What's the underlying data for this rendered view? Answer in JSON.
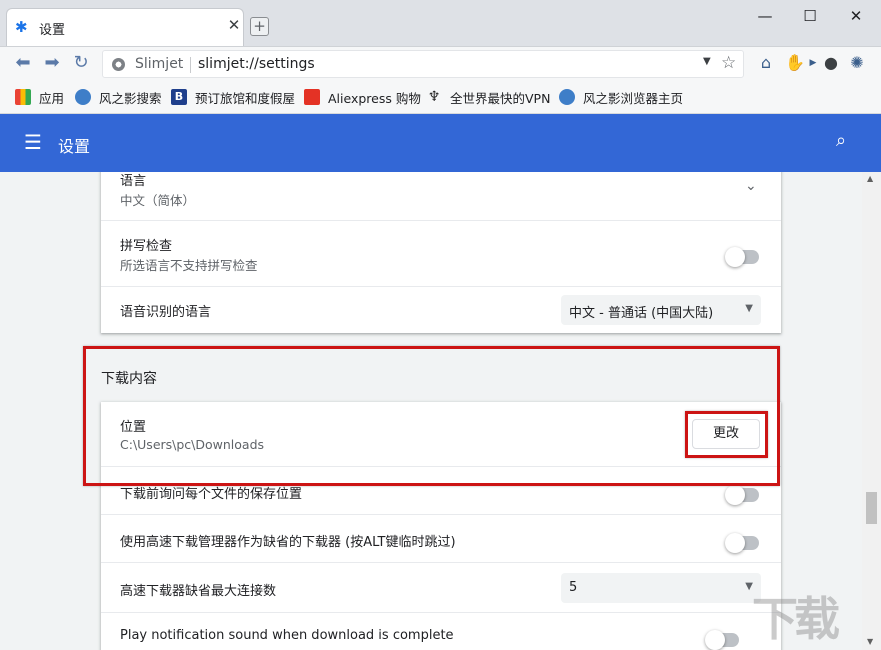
{
  "window": {
    "tab_title": "设置",
    "new_tab_symbol": "+",
    "close_tab_symbol": "✕",
    "minimize_symbol": "—",
    "maximize_symbol": "☐",
    "close_symbol": "✕"
  },
  "toolbar": {
    "site_name": "Slimjet",
    "url": "slimjet://settings"
  },
  "bookmarks": [
    {
      "label": "应用",
      "icon": "apps-grid-icon"
    },
    {
      "label": "风之影搜索",
      "icon": "globe-icon"
    },
    {
      "label": "预订旅馆和度假屋",
      "icon": "booking-icon",
      "icon_text": "B"
    },
    {
      "label": "Aliexpress 购物",
      "icon": "aliexpress-icon"
    },
    {
      "label": "全世界最快的VPN",
      "icon": "vpn-icon"
    },
    {
      "label": "风之影浏览器主页",
      "icon": "globe-icon"
    }
  ],
  "header": {
    "title": "设置"
  },
  "languages_card": {
    "language_label": "语言",
    "language_value": "中文（简体）",
    "spellcheck_label": "拼写检查",
    "spellcheck_desc": "所选语言不支持拼写检查",
    "speech_label": "语音识别的语言",
    "speech_value": "中文 - 普通话 (中国大陆)"
  },
  "downloads_section": {
    "title": "下载内容",
    "location_label": "位置",
    "location_value": "C:\\Users\\pc\\Downloads",
    "change_button": "更改",
    "ask_label": "下载前询问每个文件的保存位置",
    "fast_manager_label": "使用高速下载管理器作为缺省的下载器 (按ALT键临时跳过)",
    "max_connections_label": "高速下载器缺省最大连接数",
    "max_connections_value": "5",
    "notification_label": "Play notification sound when download is complete"
  },
  "colors": {
    "accent": "#3367d6",
    "highlight": "#cc1414"
  }
}
